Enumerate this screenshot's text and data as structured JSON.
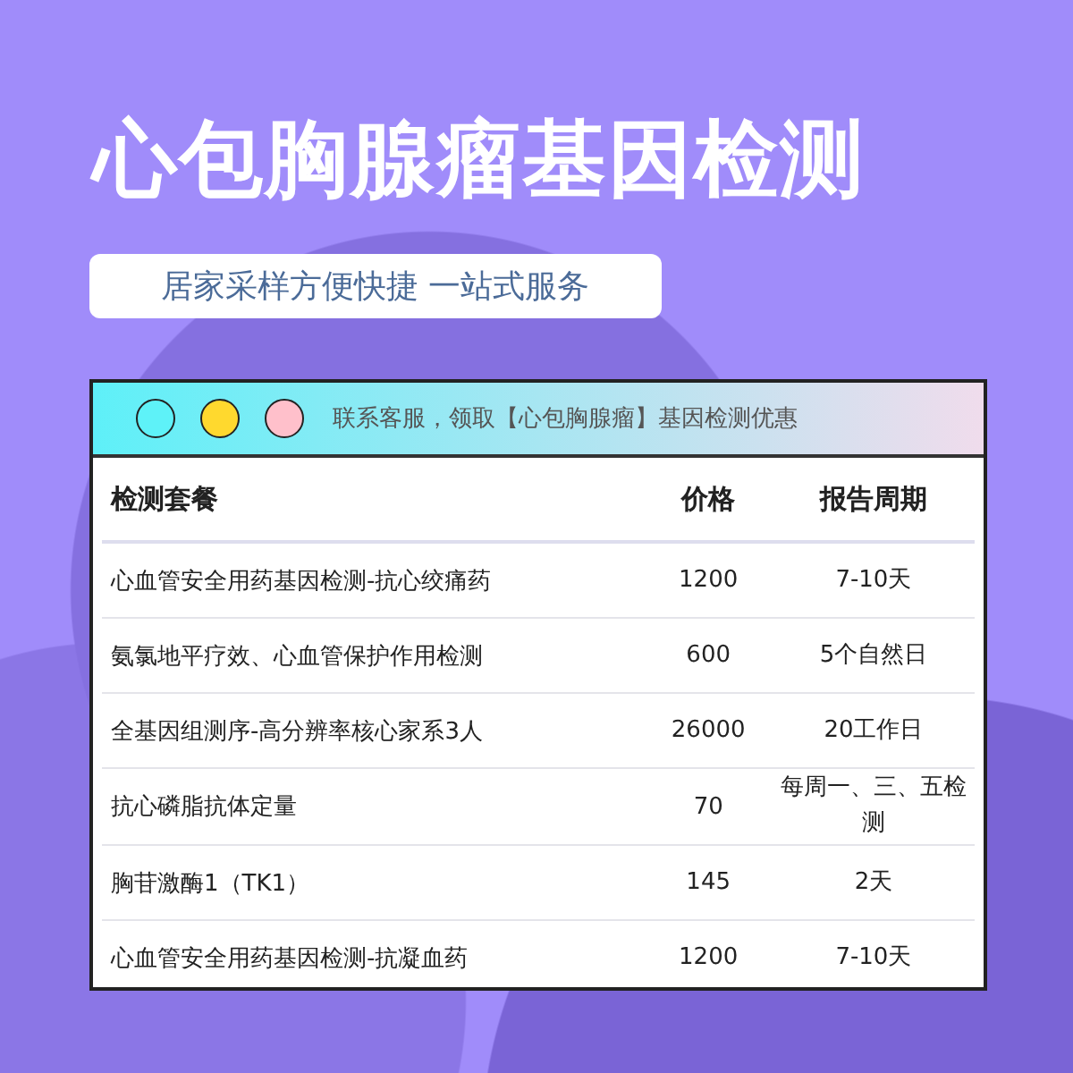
{
  "title": "心包胸腺瘤基因检测",
  "subtitle": "居家采样方便快捷 一站式服务",
  "window": {
    "dots": [
      {
        "color": "#5ef2f8"
      },
      {
        "color": "#ffd92e"
      },
      {
        "color": "#ffc0cb"
      }
    ],
    "title": "联系客服，领取【心包胸腺瘤】基因检测优惠"
  },
  "table": {
    "columns": [
      "检测套餐",
      "价格",
      "报告周期"
    ],
    "rows": [
      {
        "cells": [
          "心血管安全用药基因检测-抗心绞痛药",
          "1200",
          "7-10天"
        ]
      },
      {
        "cells": [
          "氨氯地平疗效、心血管保护作用检测",
          "600",
          "5个自然日"
        ]
      },
      {
        "cells": [
          "全基因组测序-高分辨率核心家系3人",
          "26000",
          "20工作日"
        ]
      },
      {
        "cells": [
          "抗心磷脂抗体定量",
          "70",
          "每周一、三、五检测"
        ]
      },
      {
        "cells": [
          "胸苷激酶1（TK1）",
          "145",
          "2天"
        ]
      },
      {
        "cells": [
          "心血管安全用药基因检测-抗凝血药",
          "1200",
          "7-10天"
        ]
      }
    ]
  }
}
